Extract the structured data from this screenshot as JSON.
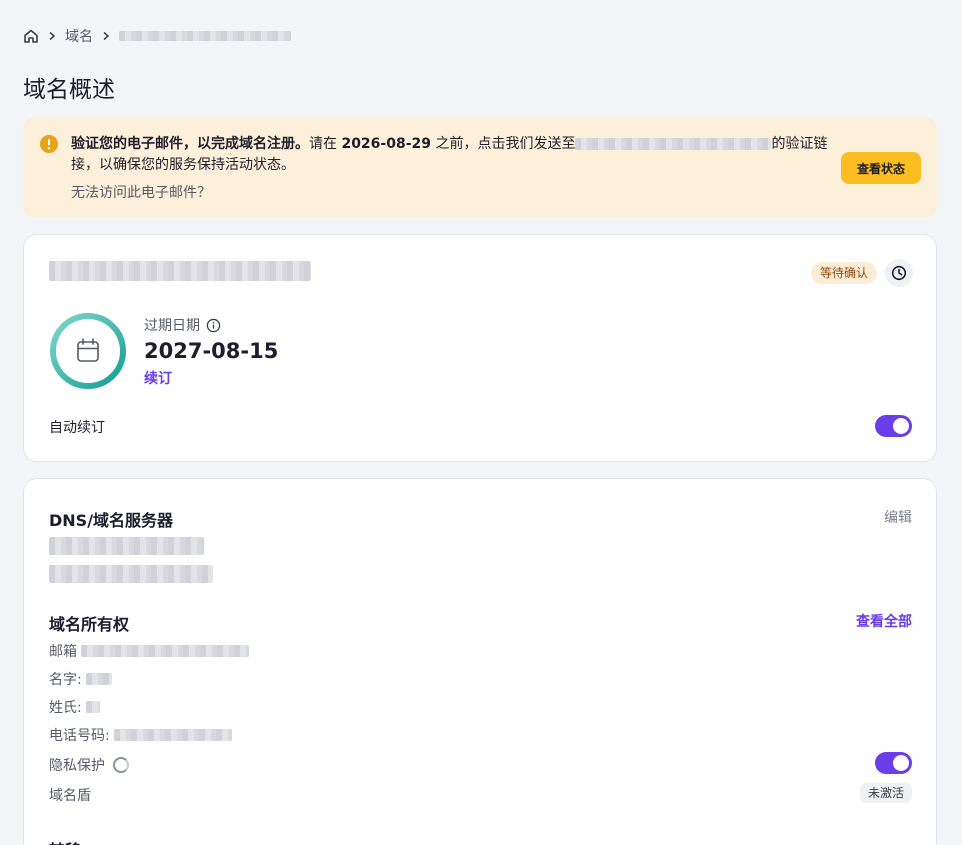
{
  "breadcrumb": {
    "home": "home-icon",
    "domains": "域名"
  },
  "page": {
    "title": "域名概述"
  },
  "alert": {
    "bold": "验证您的电子邮件，以完成域名注册。",
    "text_a": "请在",
    "deadline": "2026-08-29",
    "text_b": "之前，点击我们发送至",
    "text_c": "的验证链接，以确保您的服务保持活动状态。",
    "help": "无法访问此电子邮件？",
    "button": "查看状态",
    "color": "#fdf0db",
    "button_color": "#fbbd20"
  },
  "domain_card": {
    "status_badge": "等待确认",
    "expiry_label": "过期日期",
    "expiry_date": "2027-08-15",
    "renew_link": "续订",
    "auto_renew_label": "自动续订",
    "auto_renew_on": true,
    "ring_color": "#1aa59a"
  },
  "dns": {
    "title": "DNS/域名服务器",
    "edit": "编辑"
  },
  "ownership": {
    "title": "域名所有权",
    "view_all": "查看全部",
    "email_label": "邮箱",
    "first_name_label": "名字:",
    "last_name_label": "姓氏:",
    "phone_label": "电话号码:",
    "privacy_label": "隐私保护",
    "privacy_on": true,
    "shield_label": "域名盾",
    "shield_status": "未激活"
  },
  "transfer": {
    "title": "转移"
  },
  "accent": "#6a3de8"
}
